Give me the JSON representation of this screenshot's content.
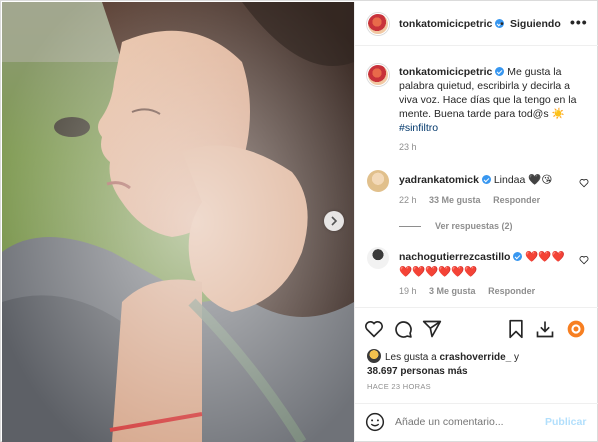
{
  "post": {
    "username": "tonkatomicicpetric",
    "follow_separator": "•",
    "follow_label": "Siguiendo",
    "more_label": "•••"
  },
  "caption": {
    "username": "tonkatomicicpetric",
    "text": "Me gusta la palabra quietud, escribirla y decirla a viva voz. Hace días que la tengo en la mente. Buena tarde para tod@s ☀️",
    "hashtag": "#sinfiltro",
    "time": "23 h"
  },
  "comments": [
    {
      "username": "yadrankatomick",
      "text": "Lindaa 🖤😘",
      "time": "22 h",
      "likes": "33 Me gusta",
      "reply": "Responder",
      "replies_label": "Ver respuestas (2)"
    },
    {
      "username": "nachogutierrezcastillo",
      "text": "❤️❤️❤️ ❤️❤️❤️❤️❤️❤️",
      "time": "19 h",
      "likes": "3 Me gusta",
      "reply": "Responder"
    }
  ],
  "likes": {
    "prefix": "Les gusta a",
    "user": "crashoverride_",
    "connector": "y",
    "others": "38.697 personas más"
  },
  "posted_ago": "HACE 23 HORAS",
  "comment_input": {
    "placeholder": "Añade un comentario...",
    "publish_label": "Publicar"
  },
  "icons": [
    "heart-icon",
    "comment-icon",
    "share-icon",
    "bookmark-icon",
    "download-icon",
    "extension-icon",
    "emoji-icon",
    "chevron-right-icon",
    "more-icon",
    "verified-icon"
  ],
  "colors": {
    "text": "#262626",
    "muted": "#8e8e8e",
    "link": "#00376b",
    "verified": "#3897f0",
    "publish_disabled": "#b2dffc",
    "border": "#dbdbdb"
  }
}
